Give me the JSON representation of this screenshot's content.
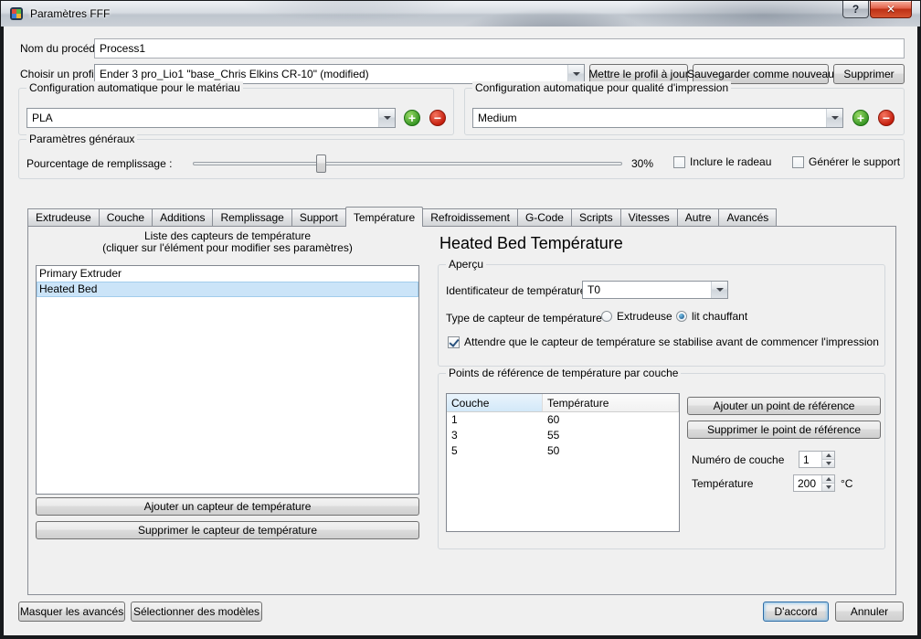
{
  "window": {
    "title": "Paramètres FFF",
    "help_button": "?",
    "close_button": "✕"
  },
  "icons": {
    "add": "+",
    "remove": "−"
  },
  "colors": {
    "selection": "#cbe4f8",
    "default_button_border": "#2d6ca5",
    "add_green": "#2f901f",
    "remove_red": "#bf1505"
  },
  "header": {
    "process_name_label": "Nom du procédé :",
    "process_name_value": "Process1",
    "profile_label": "Choisir un profil :",
    "profile_value": "Ender 3 pro_Lio1 \"base_Chris Elkins CR-10\" (modified)",
    "update_profile_button": "Mettre le profil à jour",
    "save_as_new_button": "Sauvegarder comme nouveau",
    "delete_button": "Supprimer"
  },
  "material_config": {
    "title": "Configuration automatique pour le matériau",
    "value": "PLA"
  },
  "quality_config": {
    "title": "Configuration automatique pour qualité d'impression",
    "value": "Medium"
  },
  "general": {
    "title": "Paramètres généraux",
    "infill_label": "Pourcentage de remplissage :",
    "infill_percent": 30,
    "infill_value": "30%",
    "raft_label": "Inclure le radeau",
    "support_label": "Générer le support"
  },
  "tabs": [
    "Extrudeuse",
    "Couche",
    "Additions",
    "Remplissage",
    "Support",
    "Température",
    "Refroidissement",
    "G-Code",
    "Scripts",
    "Vitesses",
    "Autre",
    "Avancés"
  ],
  "selected_tab": "Température",
  "temperature_tab": {
    "list_title": "Liste des capteurs de température",
    "list_subtitle": "(cliquer sur l'élément pour modifier ses paramètres)",
    "sensors": [
      "Primary Extruder",
      "Heated Bed"
    ],
    "selected_sensor": "Heated Bed",
    "add_sensor_button": "Ajouter un capteur de température",
    "remove_sensor_button": "Supprimer le capteur de température",
    "heading": "Heated Bed Température",
    "overview": {
      "title": "Aperçu",
      "identifier_label": "Identificateur de température",
      "identifier_value": "T0",
      "type_label": "Type de capteur de température :",
      "radio_extruder": "Extrudeuse",
      "radio_bed": "lit chauffant",
      "selected_type": "lit chauffant",
      "wait_checkbox": "Attendre que le capteur de température se stabilise avant de commencer l'impression",
      "wait_checked": true
    },
    "setpoints": {
      "title": "Points de référence de température par couche",
      "columns": [
        "Couche",
        "Température"
      ],
      "rows": [
        [
          "1",
          "60"
        ],
        [
          "3",
          "55"
        ],
        [
          "5",
          "50"
        ]
      ],
      "add_button": "Ajouter un point de référence",
      "remove_button": "Supprimer le point de référence",
      "layer_label": "Numéro de couche",
      "layer_value": "1",
      "temp_label": "Température",
      "temp_value": "200",
      "temp_unit": "°C"
    }
  },
  "footer": {
    "hide_advanced_button": "Masquer les avancés",
    "select_models_button": "Sélectionner des modèles",
    "ok_button": "D'accord",
    "cancel_button": "Annuler"
  }
}
